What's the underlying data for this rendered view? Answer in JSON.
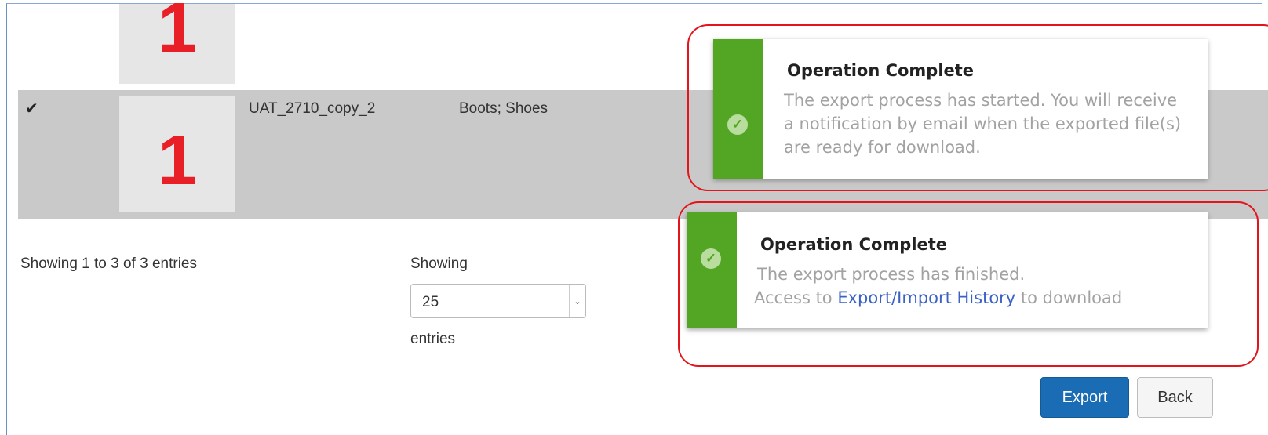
{
  "table": {
    "rows": [
      {
        "thumbnail_text": "1"
      },
      {
        "thumbnail_text": "1",
        "check_icon": "check-icon",
        "name": "UAT_2710_copy_2",
        "categories": "Boots; Shoes"
      }
    ]
  },
  "pagination": {
    "info": "Showing 1 to 3 of 3 entries",
    "showing_label": "Showing",
    "page_size": "25",
    "entries_label": "entries"
  },
  "notifications": [
    {
      "title": "Operation Complete",
      "message": "The export process has started. You will receive a notification by email when the exported file(s) are ready for download."
    },
    {
      "title": "Operation Complete",
      "message_line1": "The export process has finished.",
      "message_prefix": "Access to ",
      "link_text": "Export/Import History",
      "message_suffix": " to download"
    }
  ],
  "buttons": {
    "export": "Export",
    "back": "Back"
  },
  "colors": {
    "success": "#52a624",
    "primary": "#1a6db4",
    "highlight": "#e3141b",
    "link": "#3a62c4"
  }
}
